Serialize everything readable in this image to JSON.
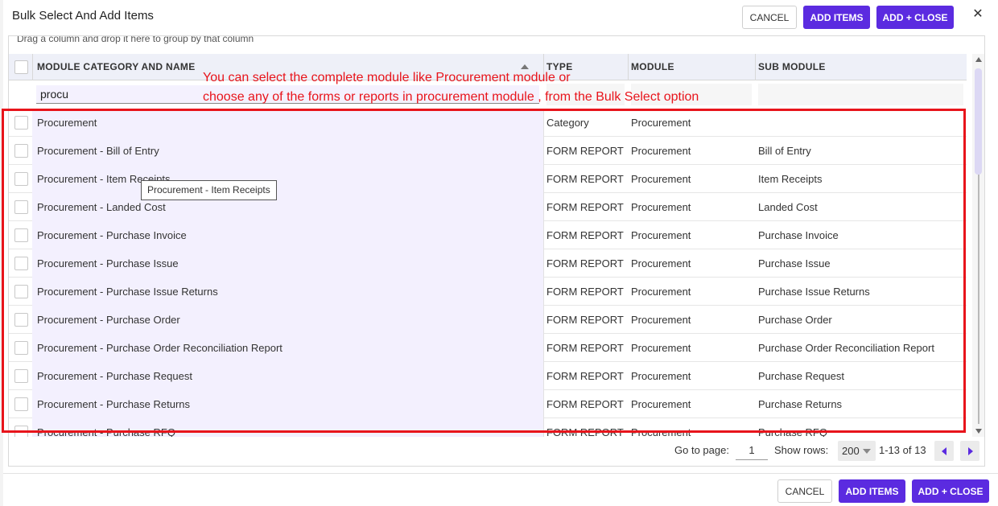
{
  "dialog": {
    "title": "Bulk Select And Add Items",
    "header_buttons": {
      "cancel": "CANCEL",
      "add_items": "ADD ITEMS",
      "add_close": "ADD + CLOSE"
    },
    "close_glyph": "✕",
    "footer_buttons": {
      "cancel": "CANCEL",
      "add_items": "ADD ITEMS",
      "add_close": "ADD + CLOSE"
    },
    "accent_color": "#5b2be0"
  },
  "grid": {
    "group_hint": "Drag a column and drop it here to group by that column",
    "columns": [
      "MODULE CATEGORY AND NAME",
      "TYPE",
      "MODULE",
      "SUB MODULE"
    ],
    "filter_value": "procu",
    "rows": [
      {
        "name": "Procurement",
        "type": "Category",
        "module": "Procurement",
        "sub": ""
      },
      {
        "name": "Procurement - Bill of Entry",
        "type": "FORM REPORT",
        "module": "Procurement",
        "sub": "Bill of Entry"
      },
      {
        "name": "Procurement - Item Receipts",
        "type": "FORM REPORT",
        "module": "Procurement",
        "sub": "Item Receipts"
      },
      {
        "name": "Procurement - Landed Cost",
        "type": "FORM REPORT",
        "module": "Procurement",
        "sub": "Landed Cost"
      },
      {
        "name": "Procurement - Purchase Invoice",
        "type": "FORM REPORT",
        "module": "Procurement",
        "sub": "Purchase Invoice"
      },
      {
        "name": "Procurement - Purchase Issue",
        "type": "FORM REPORT",
        "module": "Procurement",
        "sub": "Purchase Issue"
      },
      {
        "name": "Procurement - Purchase Issue Returns",
        "type": "FORM REPORT",
        "module": "Procurement",
        "sub": "Purchase Issue Returns"
      },
      {
        "name": "Procurement - Purchase Order",
        "type": "FORM REPORT",
        "module": "Procurement",
        "sub": "Purchase Order"
      },
      {
        "name": "Procurement - Purchase Order Reconciliation Report",
        "type": "FORM REPORT",
        "module": "Procurement",
        "sub": "Purchase Order Reconciliation Report"
      },
      {
        "name": "Procurement - Purchase Request",
        "type": "FORM REPORT",
        "module": "Procurement",
        "sub": "Purchase Request"
      },
      {
        "name": "Procurement - Purchase Returns",
        "type": "FORM REPORT",
        "module": "Procurement",
        "sub": "Purchase Returns"
      },
      {
        "name": "Procurement - Purchase RFQ",
        "type": "FORM REPORT",
        "module": "Procurement",
        "sub": "Purchase RFQ"
      }
    ],
    "tooltip": "Procurement - Item Receipts"
  },
  "pager": {
    "goto_label": "Go to page:",
    "page": "1",
    "rows_label": "Show rows:",
    "rows_value": "200",
    "range": "1-13 of 13"
  },
  "annotation": {
    "line1": "You can select the complete module like Procurement module or",
    "line2": "choose any of the forms or reports in procurement module , from the Bulk Select option",
    "color": "#e8141b"
  }
}
